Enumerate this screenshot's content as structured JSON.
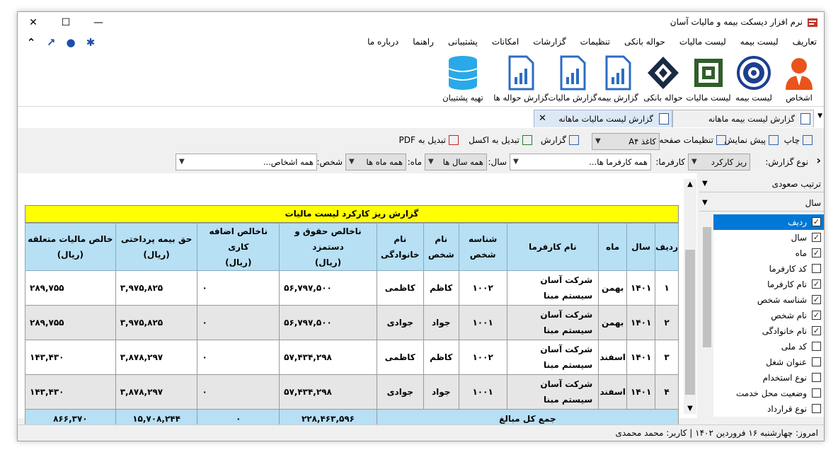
{
  "window": {
    "title": "نرم افزار دیسکت بیمه و مالیات آسان",
    "minimize": "—",
    "maximize": "☐",
    "close": "✕"
  },
  "menu": {
    "items": [
      "تعاریف",
      "لیست بیمه",
      "لیست مالیات",
      "حواله بانکی",
      "تنظیمات",
      "گزارشات",
      "امکانات",
      "پشتیبانی",
      "راهنما",
      "درباره ما"
    ],
    "icons": [
      "gear-icon",
      "user-icon",
      "arrow-icon",
      "chevron-up-icon"
    ]
  },
  "ribbon": {
    "items": [
      "اشخاص",
      "لیست بیمه",
      "لیست مالیات",
      "حواله بانکی",
      "گزارش بیمه",
      "گزارش مالیات",
      "گزارش حواله ها",
      "تهیه پشتیبان"
    ]
  },
  "tabs": [
    {
      "label": "گزارش لیست بیمه ماهانه",
      "active": false
    },
    {
      "label": "گزارش لیست مالیات ماهانه",
      "active": true
    }
  ],
  "toolbar": {
    "print": "چاپ",
    "preview": "پیش نمایش",
    "page_settings": "تنظیمات صفحه",
    "paper": "کاغذ A۴",
    "report": "گزارش",
    "excel": "تبدیل به اکسل",
    "pdf": "تبدیل به PDF"
  },
  "filters": {
    "report_type_label": "نوع گزارش:",
    "report_type_value": "ریز کارکرد",
    "employer_label": "کارفرما:",
    "employer_value": "همه کارفرما ها...",
    "year_label": "سال:",
    "year_value": "همه سال ها",
    "month_label": "ماه:",
    "month_value": "همه ماه ها",
    "person_label": "شخص:",
    "person_value": "همه اشخاص..."
  },
  "report": {
    "title": "گزارش ریز کارکرد لیست مالیات",
    "headers": [
      "ردیف",
      "سال",
      "ماه",
      "نام کارفرما",
      "شناسه\nشخص",
      "نام\nشخص",
      "نام\nخانوادگی",
      "ناخالص حقوق و دستمزد\n(ریال)",
      "ناخالص اضافه کاری\n(ریال)",
      "حق بیمه پرداختی\n(ریال)",
      "خالص مالیات متعلقه\n(ریال)"
    ],
    "rows": [
      [
        "۱",
        "۱۴۰۱",
        "بهمن",
        "شرکت آسان\nسیستم مبنا",
        "۱۰۰۲",
        "کاظم",
        "کاظمی",
        "۵۶,۷۹۷,۵۰۰",
        "۰",
        "۳,۹۷۵,۸۲۵",
        "۲۸۹,۷۵۵"
      ],
      [
        "۲",
        "۱۴۰۱",
        "بهمن",
        "شرکت آسان\nسیستم مبنا",
        "۱۰۰۱",
        "جواد",
        "جوادی",
        "۵۶,۷۹۷,۵۰۰",
        "۰",
        "۳,۹۷۵,۸۲۵",
        "۲۸۹,۷۵۵"
      ],
      [
        "۳",
        "۱۴۰۱",
        "اسفند",
        "شرکت آسان\nسیستم مبنا",
        "۱۰۰۲",
        "کاظم",
        "کاظمی",
        "۵۷,۴۳۴,۲۹۸",
        "۰",
        "۳,۸۷۸,۲۹۷",
        "۱۴۳,۴۳۰"
      ],
      [
        "۴",
        "۱۴۰۱",
        "اسفند",
        "شرکت آسان\nسیستم مبنا",
        "۱۰۰۱",
        "جواد",
        "جوادی",
        "۵۷,۴۳۴,۲۹۸",
        "۰",
        "۳,۸۷۸,۲۹۷",
        "۱۴۳,۴۳۰"
      ]
    ],
    "total_label": "جمع کل مبالغ",
    "totals": [
      "۲۲۸,۴۶۳,۵۹۶",
      "۰",
      "۱۵,۷۰۸,۲۴۴",
      "۸۶۶,۳۷۰"
    ]
  },
  "right_panel": {
    "sort": "ترتیب صعودی",
    "group": "سال",
    "columns": [
      {
        "label": "ردیف",
        "checked": true,
        "selected": true
      },
      {
        "label": "سال",
        "checked": true,
        "selected": false
      },
      {
        "label": "ماه",
        "checked": true,
        "selected": false
      },
      {
        "label": "کد کارفرما",
        "checked": false,
        "selected": false
      },
      {
        "label": "نام کارفرما",
        "checked": true,
        "selected": false
      },
      {
        "label": "شناسه شخص",
        "checked": true,
        "selected": false
      },
      {
        "label": "نام شخص",
        "checked": true,
        "selected": false
      },
      {
        "label": "نام خانوادگی",
        "checked": true,
        "selected": false
      },
      {
        "label": "کد ملی",
        "checked": false,
        "selected": false
      },
      {
        "label": "عنوان شغل",
        "checked": false,
        "selected": false
      },
      {
        "label": "نوع استخدام",
        "checked": false,
        "selected": false
      },
      {
        "label": "وضعیت محل خدمت",
        "checked": false,
        "selected": false
      },
      {
        "label": "نوع قرارداد",
        "checked": false,
        "selected": false
      }
    ]
  },
  "status": {
    "text": "امروز: چهارشنبه ۱۶ فروردین ۱۴۰۲   |   کاربر: محمد محمدی"
  },
  "colors": {
    "title_bar": "#ffff00",
    "header_bg": "#b7e0f5",
    "selection": "#0078d7"
  }
}
